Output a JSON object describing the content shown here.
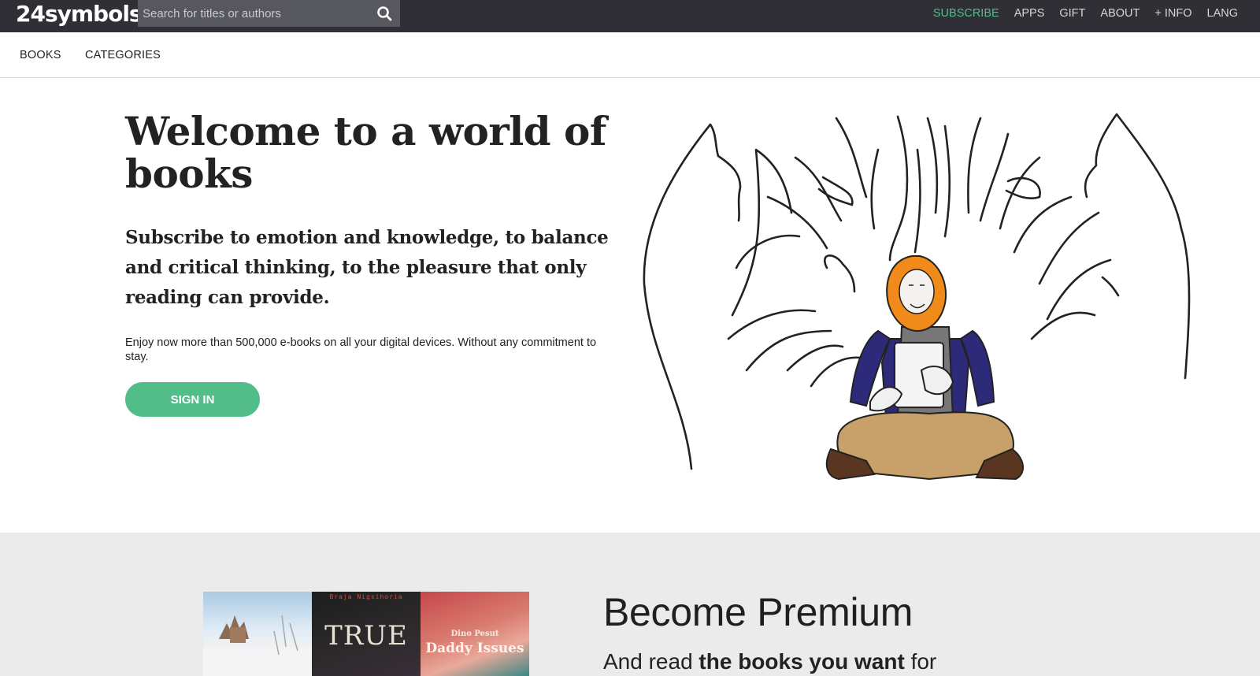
{
  "header": {
    "logo_text": "24symbols",
    "search_placeholder": "Search for titles or authors",
    "nav": {
      "subscribe": "SUBSCRIBE",
      "apps": "APPS",
      "gift": "GIFT",
      "about": "ABOUT",
      "info": "+ INFO",
      "lang": "LANG"
    },
    "accent_color": "#4fbf8b",
    "background_color": "#2f2f35"
  },
  "subnav": {
    "books": "BOOKS",
    "categories": "CATEGORIES"
  },
  "hero": {
    "title": "Welcome to a world of books",
    "subtitle": "Subscribe to emotion and knowledge, to balance and critical thinking, to the pleasure that only reading can provide.",
    "text": "Enjoy now more than 500,000 e-books on all your digital devices. Without any commitment to stay.",
    "signin_label": "SIGN IN",
    "button_color": "#52bd89"
  },
  "premium": {
    "title": "Become Premium",
    "text_start": "And read",
    "text_bold": "the books you want",
    "text_end": "for",
    "covers": [
      {
        "title": "",
        "author": ""
      },
      {
        "title": "TRUE",
        "author": "Braja Nigsihoria"
      },
      {
        "title": "Daddy Issues",
        "author": "Dino Pesut"
      }
    ]
  }
}
